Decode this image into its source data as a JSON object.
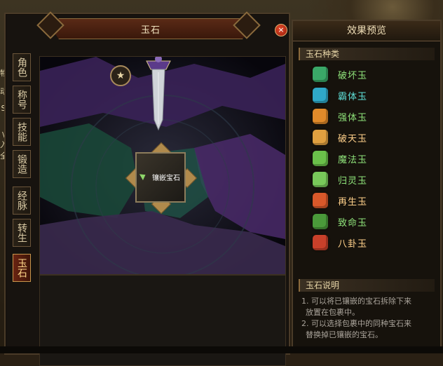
{
  "window": {
    "title": "玉石",
    "close_symbol": "×"
  },
  "background_text": [
    "物",
    "动",
    "S",
    "\\",
    "入",
    "全"
  ],
  "tabs": [
    {
      "label": "角色",
      "active": false
    },
    {
      "label": "称号",
      "active": false
    },
    {
      "label": "技能",
      "active": false
    },
    {
      "label": "锻造",
      "active": false
    },
    {
      "label": "经脉",
      "active": false
    },
    {
      "label": "转生",
      "active": false
    },
    {
      "label": "玉石",
      "active": true
    }
  ],
  "stage": {
    "badge": "★",
    "socket_label": "镶嵌宝石"
  },
  "preview": {
    "title": "效果预览",
    "gem_section_title": "玉石种类",
    "gems": [
      {
        "name": "破坏玉",
        "color": "#8fe37a",
        "icon": "gem-green-icon",
        "icon_color": "#3aa868"
      },
      {
        "name": "霸体玉",
        "color": "#5fe0d8",
        "icon": "gem-teal-icon",
        "icon_color": "#2fa8c8"
      },
      {
        "name": "强体玉",
        "color": "#8fe37a",
        "icon": "gem-orange-icon",
        "icon_color": "#e08a2a"
      },
      {
        "name": "破天玉",
        "color": "#ffd08a",
        "icon": "gem-gold-icon",
        "icon_color": "#e0a040"
      },
      {
        "name": "魔法玉",
        "color": "#8fe37a",
        "icon": "gem-lime-icon",
        "icon_color": "#6ac04a"
      },
      {
        "name": "归灵玉",
        "color": "#8fe37a",
        "icon": "gem-leaf-icon",
        "icon_color": "#78c85a"
      },
      {
        "name": "再生玉",
        "color": "#ffd08a",
        "icon": "gem-red-icon",
        "icon_color": "#d8582a"
      },
      {
        "name": "致命玉",
        "color": "#8fe37a",
        "icon": "gem-moss-icon",
        "icon_color": "#4a9a3a"
      },
      {
        "name": "八卦玉",
        "color": "#ffd08a",
        "icon": "gem-crimson-icon",
        "icon_color": "#c8402a"
      }
    ],
    "desc_section_title": "玉石说明",
    "desc_lines": [
      "1. 可以将已镶嵌的宝石拆除下来",
      "放置在包裹中。",
      "2. 可以选择包裹中的同种宝石来",
      "替换掉已镶嵌的宝石。"
    ]
  }
}
